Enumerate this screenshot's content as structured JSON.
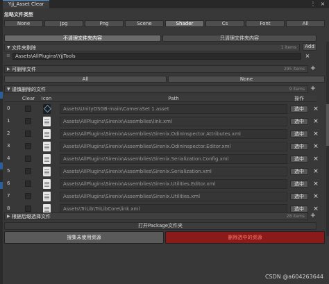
{
  "window": {
    "title": "Yjj_Asset Clear",
    "menu_glyph": "⋮",
    "close_glyph": "×"
  },
  "ignore": {
    "label": "忽略文件类型",
    "types": [
      "None",
      "Jpg",
      "Png",
      "Scene",
      "Shader",
      "Cs",
      "Font",
      "All"
    ],
    "active_index": 4
  },
  "mode": {
    "not_clean": "不清理文件夹内容",
    "only_clean": "只清理文件夹内容"
  },
  "folder_exclude": {
    "title": "文件夹剔除",
    "count": "1 items",
    "add_label": "Add",
    "value": "Assets\\AllPlugins\\YjjTools",
    "remove_glyph": "×"
  },
  "deletable": {
    "title": "可删除文件",
    "count": "295 items",
    "plus_glyph": "+",
    "options": [
      "All",
      "None"
    ]
  },
  "pending": {
    "title": "谨慎删除的文件",
    "count": "9 items",
    "columns": {
      "clear": "Clear",
      "icon": "Icon",
      "path": "Path",
      "action": "操作"
    },
    "select_label": "选中",
    "delete_glyph": "×",
    "rows": [
      {
        "idx": "0",
        "path": "Assets\\UnityOSGB-main\\CameraSet 1.asset"
      },
      {
        "idx": "1",
        "path": "Assets\\AllPlugins\\Sirenix\\Assemblies\\link.xml"
      },
      {
        "idx": "2",
        "path": "Assets\\AllPlugins\\Sirenix\\Assemblies\\Sirenix.OdinInspector.Attributes.xml"
      },
      {
        "idx": "3",
        "path": "Assets\\AllPlugins\\Sirenix\\Assemblies\\Sirenix.OdinInspector.Editor.xml"
      },
      {
        "idx": "4",
        "path": "Assets\\AllPlugins\\Sirenix\\Assemblies\\Sirenix.Serialization.Config.xml"
      },
      {
        "idx": "5",
        "path": "Assets\\AllPlugins\\Sirenix\\Assemblies\\Sirenix.Serialization.xml"
      },
      {
        "idx": "6",
        "path": "Assets\\AllPlugins\\Sirenix\\Assemblies\\Sirenix.Utilities.Editor.xml"
      },
      {
        "idx": "7",
        "path": "Assets\\AllPlugins\\Sirenix\\Assemblies\\Sirenix.Utilities.xml"
      },
      {
        "idx": "8",
        "path": "Assets\\TriLib\\TriLibCore\\link.xml"
      }
    ]
  },
  "backup": {
    "title": "根据后缀选择文件",
    "count": "28 items"
  },
  "actions": {
    "open_package": "打开Package文件夹",
    "collect": "搜集未使用资源",
    "delete_selected": "删除选中的资源"
  },
  "watermark": "CSDN @a604263644",
  "colors": {
    "accent": "#4a90d9",
    "danger": "#8b1a1a",
    "danger_text": "#ff7b6b"
  }
}
